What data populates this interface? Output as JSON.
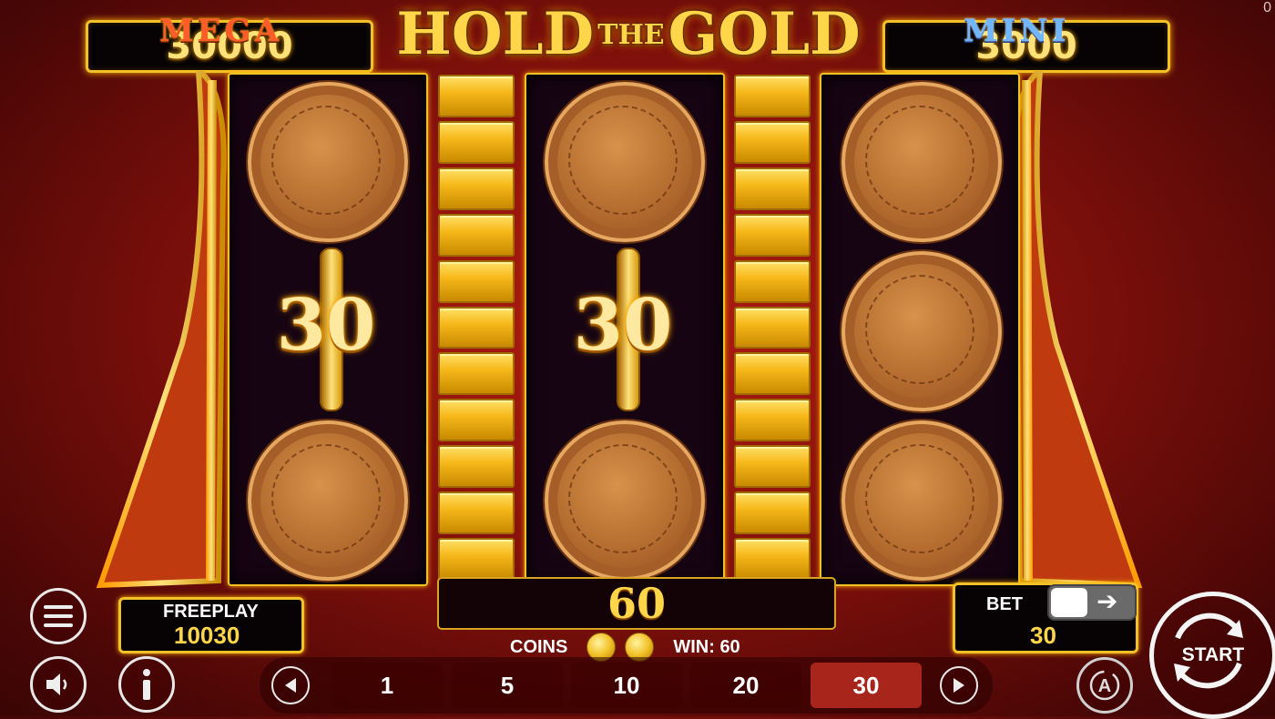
{
  "jackpots": {
    "mega": {
      "label": "MEGA",
      "value": "30000"
    },
    "mini": {
      "label": "MINI",
      "value": "3000"
    }
  },
  "logo": {
    "word1": "HOLD",
    "word2": "THE",
    "word3": "GOLD"
  },
  "reels": {
    "reel1_coin_value": "30",
    "reel2_coin_value": "30"
  },
  "win_display": {
    "total": "60"
  },
  "freeplay": {
    "label": "FREEPLAY",
    "value": "10030"
  },
  "coins_info": {
    "coins_label": "COINS",
    "win_text": "WIN: 60"
  },
  "bet": {
    "label": "BET",
    "value": "30"
  },
  "bet_options": [
    "1",
    "5",
    "10",
    "20",
    "30"
  ],
  "selected_bet": "30",
  "start_button": {
    "label": "START"
  },
  "corner_counter": "0",
  "icons": {
    "menu": "hamburger-menu-icon",
    "sound": "speaker-icon",
    "info": "info-icon",
    "prev": "chevron-left-icon",
    "next": "chevron-right-icon",
    "autoplay": "autoplay-icon"
  },
  "colors": {
    "gold": "#f2c128",
    "active_bet": "#a8251b",
    "background": "#8a120c"
  }
}
